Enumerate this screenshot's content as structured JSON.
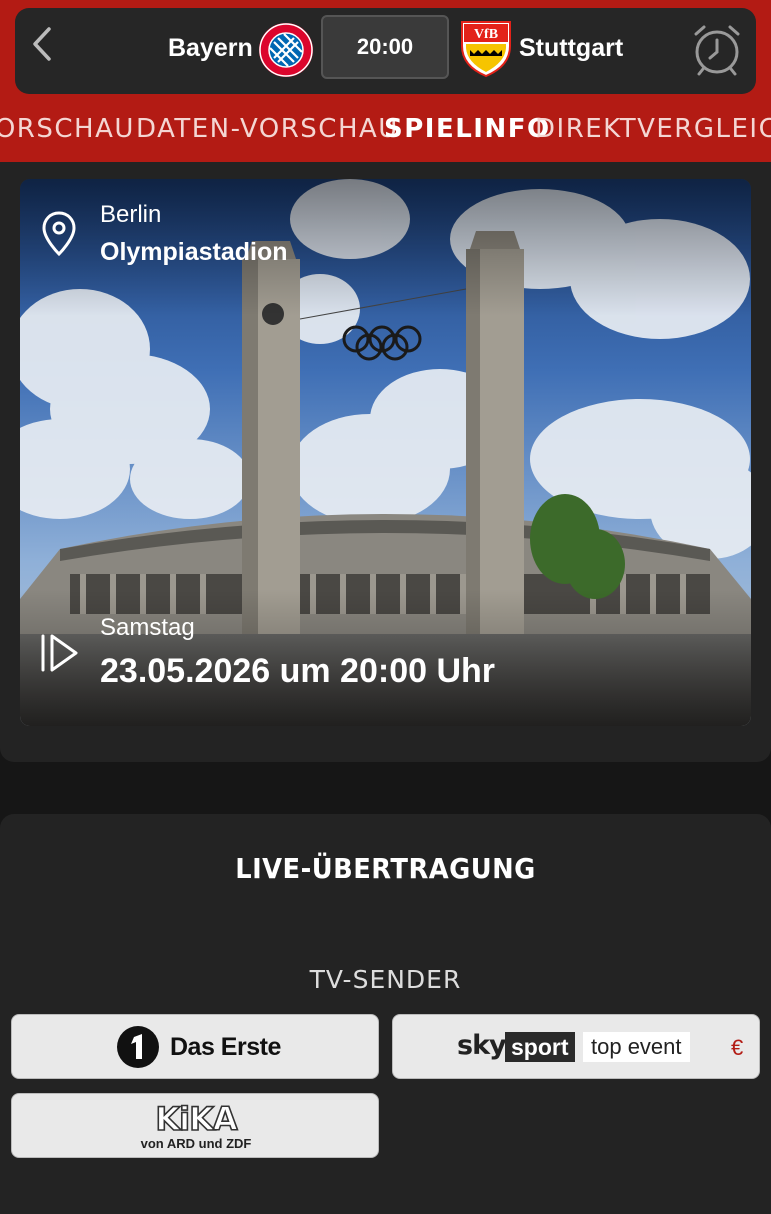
{
  "header": {
    "home_team": "Bayern",
    "away_team": "Stuttgart",
    "kickoff_time": "20:00",
    "home_crest_text": "FC BAYERN MÜNCHEN",
    "away_crest_text": "VfB"
  },
  "tabs": [
    {
      "label": "VORSCHAU",
      "active": false
    },
    {
      "label": "DATEN-VORSCHAU",
      "active": false
    },
    {
      "label": "SPIELINFO",
      "active": true
    },
    {
      "label": "DIREKTVERGLEICH",
      "active": false
    }
  ],
  "venue": {
    "city": "Berlin",
    "stadium": "Olympiastadion",
    "weekday": "Samstag",
    "datetime": "23.05.2026 um 20:00 Uhr"
  },
  "broadcast": {
    "title": "LIVE-ÜBERTRAGUNG",
    "tv_label": "TV-SENDER",
    "channels": [
      {
        "name": "Das Erste",
        "logo": "ard-one-logo"
      },
      {
        "name_parts": [
          "sky",
          "sport",
          "top event"
        ],
        "pay_badge": "€"
      },
      {
        "logo_text": "KiKA",
        "subtitle": "von ARD und ZDF"
      }
    ]
  },
  "colors": {
    "accent_red": "#b31b14",
    "background": "#161616",
    "panel": "#232323"
  }
}
